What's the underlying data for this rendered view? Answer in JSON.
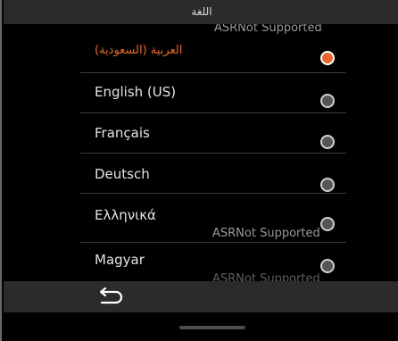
{
  "header": {
    "title": "اللغة"
  },
  "languages": [
    {
      "label": "العربية (السعودية)",
      "selected": true
    },
    {
      "label": "English (US)",
      "selected": false
    },
    {
      "label": "Français",
      "selected": false
    },
    {
      "label": "Deutsch",
      "selected": false
    },
    {
      "label": "Ελληνικά",
      "selected": false,
      "note": "ASRNot Supported"
    },
    {
      "label": "Magyar",
      "selected": false,
      "note": "ASRNot Supported"
    }
  ],
  "top_note": "ASRNot Supported",
  "colors": {
    "accent": "#e8672c",
    "bar": "#2b2b2b",
    "background": "#000000"
  },
  "icons": {
    "back": "back-arrow-icon"
  }
}
